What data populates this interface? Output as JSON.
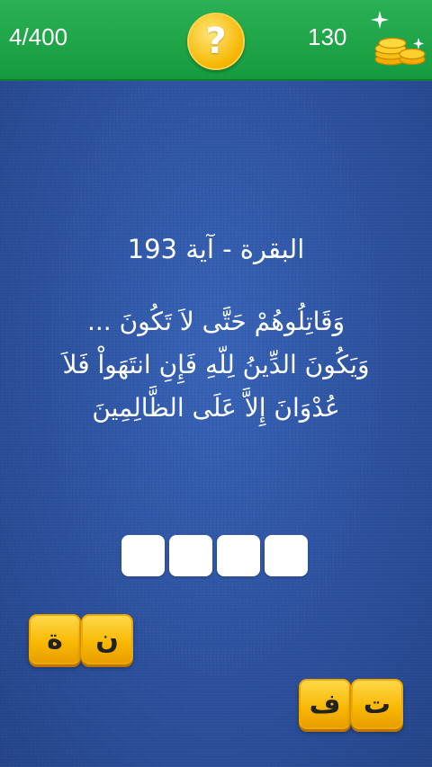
{
  "header": {
    "level": "4/400",
    "hint_symbol": "?",
    "coins": "130",
    "coins_icon": "coins-stack-sparkle-icon",
    "bar_color": "#21a84b"
  },
  "question": {
    "reference": "البقرة - آية 193",
    "verse_lines": [
      "وَقَاتِلُوهُمْ حَتَّى لاَ تَكُونَ ...",
      "وَيَكُونَ الدِّينُ لِلّهِ فَإِنِ انتَهَواْ فَلاَ",
      "عُدْوَانَ إِلاَّ عَلَى الظَّالِمِينَ"
    ]
  },
  "answer": {
    "slot_count": 4
  },
  "letters": {
    "left_group": [
      "ة",
      "ن"
    ],
    "right_group": [
      "ف",
      "ت"
    ]
  }
}
